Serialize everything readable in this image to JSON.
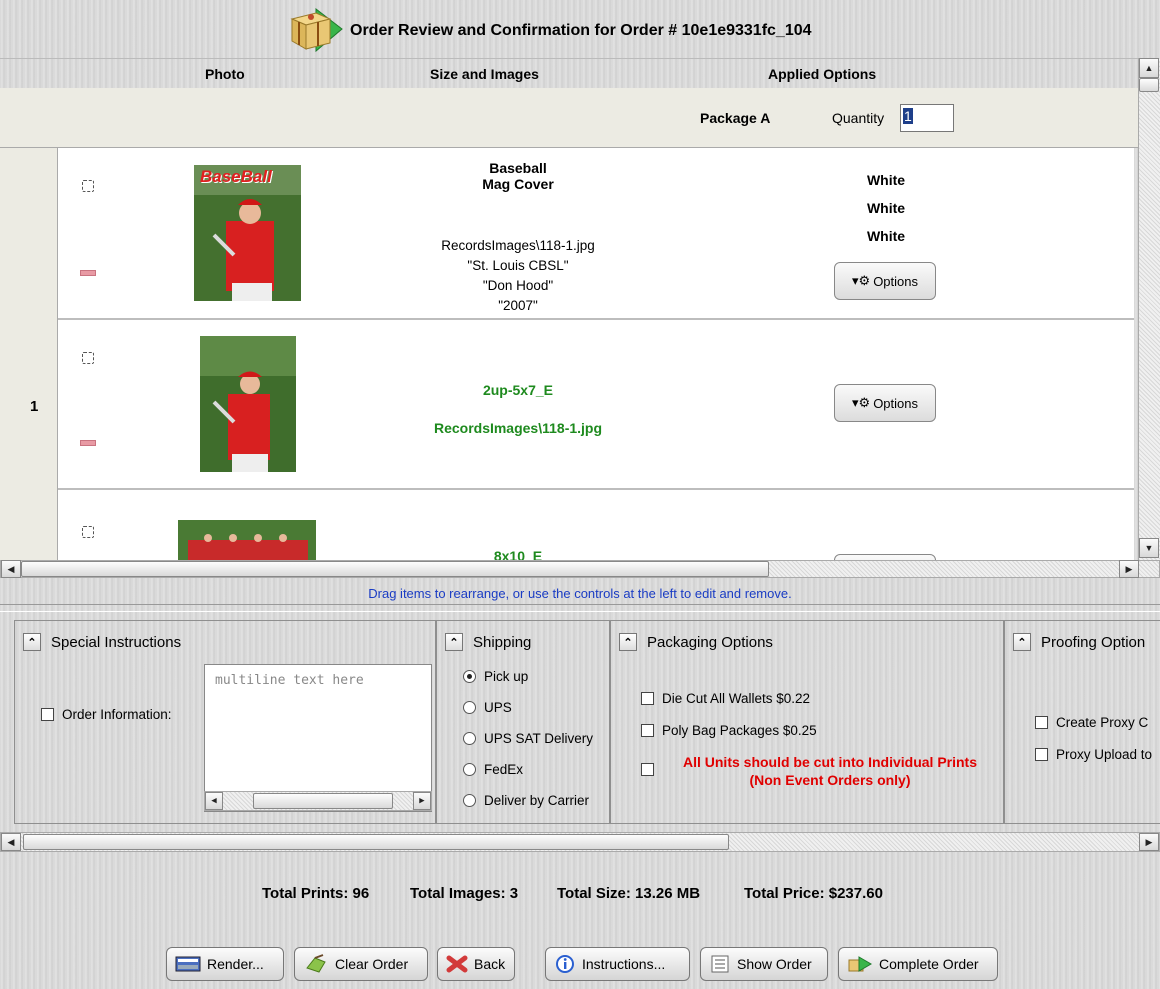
{
  "title": "Order Review and Confirmation for Order # 10e1e9331fc_104",
  "columns": {
    "photo": "Photo",
    "size_images": "Size and Images",
    "applied_options": "Applied Options"
  },
  "package": {
    "label": "Package  A",
    "quantity_label": "Quantity",
    "quantity_value": "1",
    "row_index": "1"
  },
  "items": [
    {
      "size_line1": "Baseball",
      "size_line2": "Mag Cover",
      "image_path": "RecordsImages\\118-1.jpg",
      "text1": "\"St. Louis CBSL\"",
      "text2": "\"Don Hood\"",
      "text3": "\"2007\"",
      "options": [
        "White",
        "White",
        "White"
      ],
      "options_button": "Options",
      "photo_title": "BaseBall"
    },
    {
      "size_name": "2up-5x7_E",
      "image_path": "RecordsImages\\118-1.jpg",
      "options_button": "Options"
    },
    {
      "size_name": "8x10_E"
    }
  ],
  "drag_hint": "Drag items to rearrange, or use the controls at the left to edit and remove.",
  "special_instructions": {
    "title": "Special Instructions",
    "order_info_label": "Order Information:",
    "placeholder": "multiline text here"
  },
  "shipping": {
    "title": "Shipping",
    "options": [
      "Pick up",
      "UPS",
      "UPS SAT Delivery",
      "FedEx",
      "Deliver by Carrier"
    ],
    "selected": "Pick up"
  },
  "packaging": {
    "title": "Packaging Options",
    "options": [
      "Die Cut All Wallets $0.22",
      "Poly Bag Packages $0.25"
    ],
    "warning_line1": "All Units should be cut into Individual Prints",
    "warning_line2": "(Non Event Orders only)",
    "warning_color": "#e00000"
  },
  "proofing": {
    "title": "Proofing Option",
    "options": [
      "Create Proxy C",
      "Proxy Upload to"
    ]
  },
  "totals": {
    "prints": "Total Prints: 96",
    "images": "Total Images: 3",
    "size": "Total Size: 13.26 MB",
    "price": "Total Price: $237.60"
  },
  "buttons": {
    "render": "Render...",
    "clear": "Clear Order",
    "back": "Back",
    "instructions": "Instructions...",
    "show": "Show Order",
    "complete": "Complete Order"
  },
  "colors": {
    "link_blue": "#1a3cc4",
    "green_text": "#1e8a1e",
    "selection": "#1e3f8a"
  }
}
